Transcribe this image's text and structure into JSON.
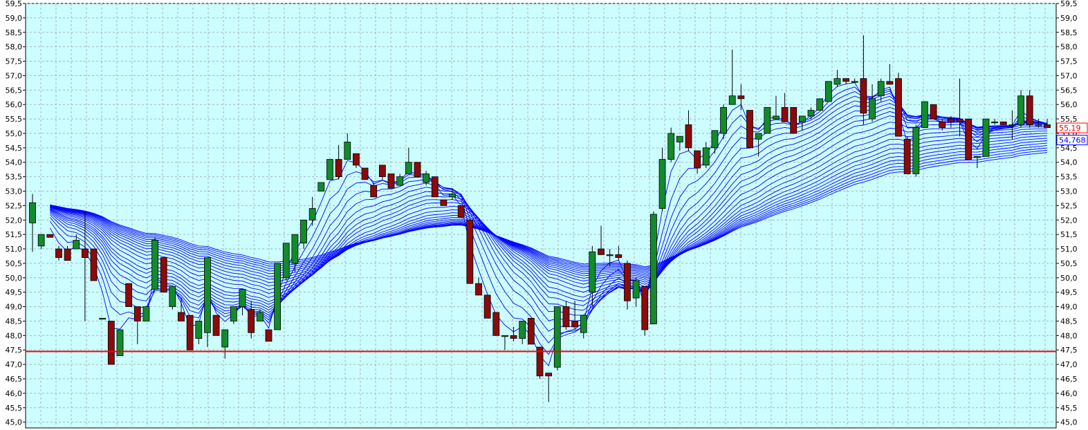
{
  "chart_data": {
    "type": "candlestick",
    "y_axis": {
      "min": 44.8,
      "max": 59.5,
      "ticks": [
        "59,5",
        "59,0",
        "58,5",
        "58,0",
        "57,5",
        "57,0",
        "56,5",
        "56,0",
        "55,5",
        "55,0",
        "54,5",
        "54,0",
        "53,5",
        "53,0",
        "52,5",
        "52,0",
        "51,5",
        "51,0",
        "50,5",
        "50,0",
        "49,5",
        "49,0",
        "48,5",
        "48,0",
        "47,5",
        "47,0",
        "46,5",
        "46,0",
        "45,5",
        "45,0"
      ],
      "tick_values": [
        59.5,
        59.0,
        58.5,
        58.0,
        57.5,
        57.0,
        56.5,
        56.0,
        55.5,
        55.0,
        54.5,
        54.0,
        53.5,
        53.0,
        52.5,
        52.0,
        51.5,
        51.0,
        50.5,
        50.0,
        49.5,
        49.0,
        48.5,
        48.0,
        47.5,
        47.0,
        46.5,
        46.0,
        45.5,
        45.0
      ],
      "sides": "left-and-right"
    },
    "grid": true,
    "reference_line": {
      "value": 47.45,
      "color": "#ff0000"
    },
    "last_price_labels": [
      {
        "text": "55,19",
        "value": 55.19,
        "color": "#ff0000"
      },
      {
        "text": "54,768",
        "value": 54.77,
        "color": "#0000ff"
      }
    ],
    "candles": [
      [
        51.9,
        52.9,
        50.9,
        52.6
      ],
      [
        51.1,
        51.5,
        51.0,
        51.5
      ],
      [
        51.5,
        51.5,
        51.4,
        51.4
      ],
      [
        51.0,
        51.1,
        50.6,
        50.7
      ],
      [
        51.0,
        51.1,
        50.6,
        50.6
      ],
      [
        51.0,
        51.5,
        51.0,
        51.3
      ],
      [
        51.0,
        52.3,
        48.5,
        50.7
      ],
      [
        51.0,
        51.0,
        50.0,
        49.9
      ],
      [
        48.6,
        48.6,
        48.6,
        48.6
      ],
      [
        48.5,
        48.5,
        47.0,
        47.0
      ],
      [
        47.3,
        48.2,
        47.3,
        48.2
      ],
      [
        49.8,
        49.8,
        49.0,
        49.0
      ],
      [
        49.0,
        49.0,
        47.7,
        48.5
      ],
      [
        48.5,
        49.0,
        48.5,
        49.0
      ],
      [
        49.6,
        51.4,
        49.6,
        51.3
      ],
      [
        50.7,
        50.7,
        49.5,
        49.5
      ],
      [
        49.0,
        49.6,
        48.9,
        49.7
      ],
      [
        48.8,
        49.3,
        48.5,
        48.5
      ],
      [
        48.7,
        48.7,
        47.5,
        47.5
      ],
      [
        47.9,
        48.5,
        47.7,
        48.5
      ],
      [
        48.1,
        50.7,
        47.6,
        50.7
      ],
      [
        48.7,
        48.7,
        48.0,
        48.0
      ],
      [
        47.6,
        48.2,
        47.2,
        48.2
      ],
      [
        48.5,
        49.0,
        48.4,
        49.0
      ],
      [
        49.0,
        49.6,
        48.7,
        49.6
      ],
      [
        48.9,
        49.2,
        47.9,
        48.1
      ],
      [
        48.5,
        48.9,
        48.5,
        48.8
      ],
      [
        48.2,
        48.2,
        47.8,
        47.8
      ],
      [
        48.2,
        50.5,
        48.2,
        50.5
      ],
      [
        50.0,
        51.2,
        49.9,
        51.2
      ],
      [
        50.5,
        51.5,
        50.2,
        51.5
      ],
      [
        51.2,
        52.0,
        51.0,
        52.0
      ],
      [
        52.0,
        52.8,
        51.8,
        52.4
      ],
      [
        53.0,
        53.3,
        53.0,
        53.3
      ],
      [
        53.4,
        54.1,
        53.4,
        54.1
      ],
      [
        54.1,
        54.6,
        53.4,
        53.5
      ],
      [
        54.1,
        55.0,
        54.1,
        54.7
      ],
      [
        54.3,
        54.3,
        53.8,
        53.9
      ],
      [
        53.8,
        53.8,
        53.5,
        53.4
      ],
      [
        53.2,
        53.3,
        52.8,
        52.8
      ],
      [
        53.9,
        53.9,
        53.4,
        53.5
      ],
      [
        53.6,
        53.6,
        53.1,
        53.1
      ],
      [
        53.2,
        53.6,
        53.2,
        53.5
      ],
      [
        53.6,
        54.5,
        53.6,
        54.0
      ],
      [
        54.0,
        54.0,
        53.5,
        53.5
      ],
      [
        53.3,
        53.7,
        53.2,
        53.6
      ],
      [
        53.5,
        53.5,
        52.8,
        52.8
      ],
      [
        52.7,
        52.7,
        52.5,
        52.5
      ],
      [
        52.8,
        53.1,
        52.7,
        52.9
      ],
      [
        52.5,
        52.5,
        52.1,
        52.1
      ],
      [
        52.0,
        52.0,
        49.8,
        49.8
      ],
      [
        49.8,
        50.0,
        49.4,
        49.4
      ],
      [
        49.4,
        49.4,
        48.6,
        48.6
      ],
      [
        48.8,
        48.8,
        48.0,
        48.0
      ],
      [
        48.0,
        48.0,
        47.5,
        48.0
      ],
      [
        48.0,
        48.3,
        47.8,
        47.9
      ],
      [
        47.9,
        48.5,
        47.7,
        48.5
      ],
      [
        48.6,
        48.6,
        47.7,
        47.7
      ],
      [
        47.6,
        47.6,
        46.5,
        46.6
      ],
      [
        46.7,
        46.7,
        45.7,
        46.6
      ],
      [
        46.9,
        49.0,
        46.8,
        49.0
      ],
      [
        49.0,
        49.2,
        48.2,
        48.3
      ],
      [
        48.5,
        49.2,
        48.2,
        48.3
      ],
      [
        48.1,
        48.7,
        47.9,
        48.7
      ],
      [
        49.5,
        51.1,
        49.0,
        50.9
      ],
      [
        51.0,
        51.8,
        50.9,
        50.8
      ],
      [
        50.8,
        51.0,
        50.4,
        50.8
      ],
      [
        50.8,
        51.1,
        50.6,
        50.7
      ],
      [
        50.5,
        50.6,
        48.9,
        49.2
      ],
      [
        49.3,
        50.0,
        49.0,
        49.9
      ],
      [
        49.7,
        49.7,
        48.0,
        48.2
      ],
      [
        48.4,
        52.3,
        48.4,
        52.2
      ],
      [
        52.4,
        54.5,
        52.3,
        54.1
      ],
      [
        54.1,
        55.2,
        54.0,
        55.0
      ],
      [
        54.7,
        54.9,
        54.4,
        54.9
      ],
      [
        55.3,
        55.8,
        54.4,
        54.5
      ],
      [
        54.4,
        54.4,
        53.6,
        53.8
      ],
      [
        53.9,
        54.7,
        53.8,
        54.5
      ],
      [
        54.5,
        55.1,
        54.3,
        55.1
      ],
      [
        55.0,
        56.0,
        54.8,
        55.9
      ],
      [
        56.0,
        57.9,
        56.0,
        56.3
      ],
      [
        56.3,
        56.7,
        55.8,
        56.2
      ],
      [
        55.8,
        55.8,
        54.5,
        54.5
      ],
      [
        54.8,
        55.0,
        54.2,
        55.0
      ],
      [
        55.0,
        55.9,
        55.0,
        55.9
      ],
      [
        55.5,
        56.3,
        55.5,
        55.6
      ],
      [
        55.9,
        56.4,
        55.4,
        55.4
      ],
      [
        55.9,
        55.9,
        55.0,
        55.0
      ],
      [
        55.4,
        55.6,
        55.1,
        55.6
      ],
      [
        55.6,
        55.9,
        55.5,
        55.8
      ],
      [
        55.8,
        56.2,
        55.8,
        56.2
      ],
      [
        56.1,
        56.8,
        56.1,
        56.8
      ],
      [
        56.7,
        57.2,
        56.6,
        56.9
      ],
      [
        56.9,
        56.9,
        56.7,
        56.8
      ],
      [
        56.8,
        56.9,
        56.8,
        56.8
      ],
      [
        56.9,
        58.4,
        55.3,
        55.7
      ],
      [
        55.5,
        56.7,
        55.4,
        56.2
      ],
      [
        56.3,
        56.9,
        56.1,
        56.8
      ],
      [
        56.8,
        57.4,
        56.7,
        56.7
      ],
      [
        56.9,
        57.1,
        54.9,
        54.9
      ],
      [
        54.8,
        54.9,
        53.6,
        53.6
      ],
      [
        53.6,
        55.3,
        53.5,
        55.2
      ],
      [
        55.2,
        56.1,
        55.2,
        56.1
      ],
      [
        56.0,
        56.0,
        55.5,
        55.5
      ],
      [
        55.4,
        55.5,
        55.1,
        55.2
      ],
      [
        55.5,
        55.6,
        55.2,
        55.4
      ],
      [
        55.5,
        56.9,
        54.9,
        55.4
      ],
      [
        55.5,
        55.5,
        54.2,
        54.1
      ],
      [
        54.2,
        54.2,
        53.8,
        54.2
      ],
      [
        54.2,
        55.5,
        54.2,
        55.5
      ],
      [
        55.4,
        55.5,
        55.3,
        55.4
      ],
      [
        55.4,
        55.4,
        55.4,
        55.3
      ],
      [
        55.3,
        55.8,
        54.8,
        55.3
      ],
      [
        55.3,
        56.5,
        55.2,
        56.3
      ],
      [
        56.3,
        56.5,
        55.2,
        55.3
      ],
      [
        55.3,
        55.5,
        55.2,
        55.3
      ],
      [
        55.3,
        55.5,
        55.2,
        55.2
      ]
    ]
  }
}
